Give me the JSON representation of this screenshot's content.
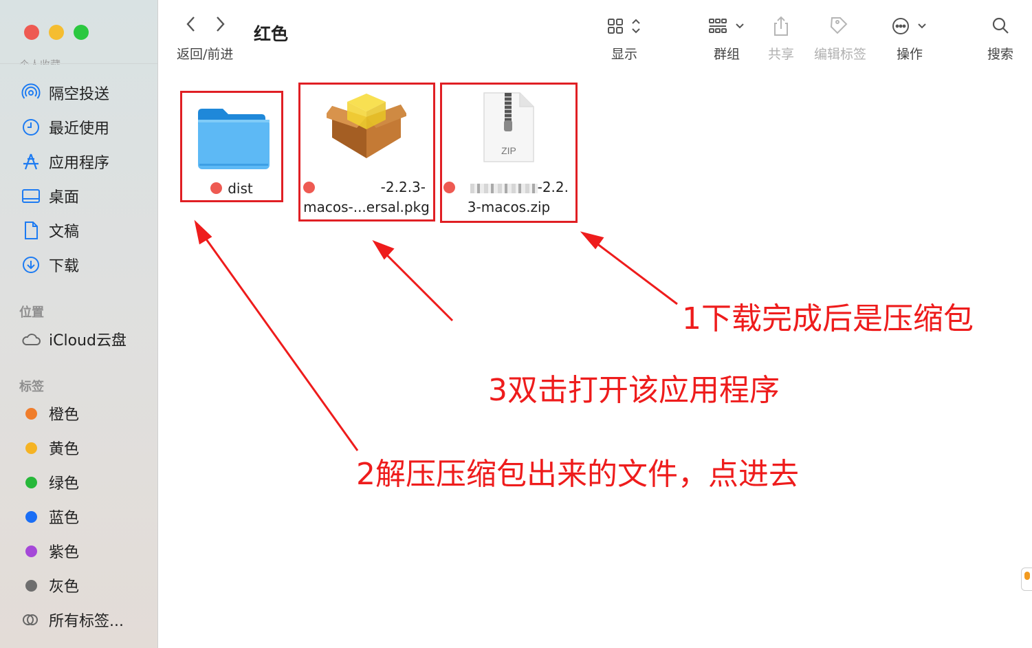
{
  "window": {
    "title": "红色"
  },
  "toolbar": {
    "back_forward_label": "返回/前进",
    "view_label": "显示",
    "group_label": "群组",
    "share_label": "共享",
    "edit_tags_label": "编辑标签",
    "action_label": "操作",
    "search_label": "搜索"
  },
  "sidebar": {
    "cut_heading": "个人收藏",
    "favorites": [
      {
        "label": "隔空投送",
        "icon": "airdrop-icon"
      },
      {
        "label": "最近使用",
        "icon": "clock-icon"
      },
      {
        "label": "应用程序",
        "icon": "applications-icon"
      },
      {
        "label": "桌面",
        "icon": "desktop-icon"
      },
      {
        "label": "文稿",
        "icon": "document-icon"
      },
      {
        "label": "下载",
        "icon": "download-icon"
      }
    ],
    "locations_heading": "位置",
    "locations": [
      {
        "label": "iCloud云盘",
        "icon": "cloud-icon"
      }
    ],
    "tags_heading": "标签",
    "tags": [
      {
        "label": "橙色",
        "color": "#f07d2b"
      },
      {
        "label": "黄色",
        "color": "#f5b324"
      },
      {
        "label": "绿色",
        "color": "#27b83a"
      },
      {
        "label": "蓝色",
        "color": "#1a6ef5"
      },
      {
        "label": "紫色",
        "color": "#a548d8"
      },
      {
        "label": "灰色",
        "color": "#6e6e6e"
      }
    ],
    "all_tags": "所有标签..."
  },
  "files": [
    {
      "name_line1": "dist",
      "name_line2": "",
      "kind": "folder",
      "tag_color": "#ee5a52"
    },
    {
      "name_line1": "-2.2.3-",
      "name_line2": "macos-...ersal.pkg",
      "kind": "package",
      "tag_color": "#ee5a52"
    },
    {
      "name_line1": "-2.2.",
      "name_line2": "3-macos.zip",
      "kind": "zip",
      "zip_text": "ZIP",
      "tag_color": "#ee5a52"
    }
  ],
  "annotations": {
    "step1": "1下载完成后是压缩包",
    "step2": "2解压压缩包出来的文件，点进去",
    "step3": "3双击打开该应用程序"
  },
  "colors": {
    "annotation_red": "#ee1c1c",
    "box_red": "#e01f24"
  }
}
